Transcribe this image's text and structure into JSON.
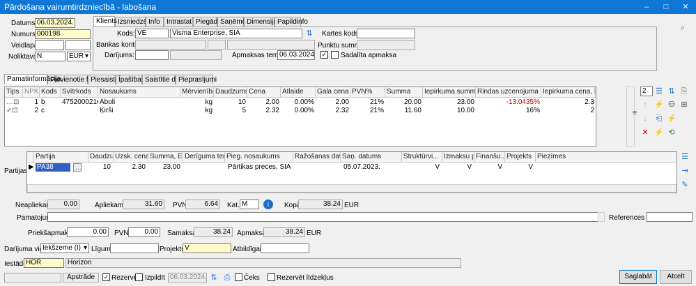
{
  "window": {
    "title": "Pārdošana vairumtirdzniecībā - labošana",
    "minimize": "–",
    "maximize": "□",
    "close": "✕"
  },
  "header": {
    "datums_label": "Datums:",
    "datums": "06.03.2024.",
    "numurs_label": "Numurs:",
    "numurs": "000198",
    "veidlapa_label": "Veidlapa:",
    "noliktava_label": "Noliktava:",
    "noliktava": "N",
    "currency": "EUR"
  },
  "top_tabs": [
    "Klients",
    "Izsniedzējs",
    "Info",
    "Intrastat",
    "Piegāde",
    "Saņēmējs",
    "Dimensijas",
    "Papildinfo"
  ],
  "client": {
    "kods_label": "Kods:",
    "kods": "VE",
    "name": "Visma Enterprise, SIA",
    "bankas_label": "Bankas konts:",
    "darijums_label": "Darījums:",
    "kartes_label": "Kartes kods:",
    "punktu_label": "Punktu summa:",
    "apmaksas_label": "Apmaksas termiņš:",
    "apmaksas": "06.03.2024.",
    "sadalita_label": "Sadalīta apmaksa"
  },
  "mid_tabs": [
    "Pamatinformācija",
    "Pievienotie faili",
    "Piesaistes",
    "Īpašības",
    "Saistītie dati",
    "Pieprasījumi"
  ],
  "items": {
    "columns": [
      "Tips",
      "NPK",
      "Kods",
      "Svītrkods",
      "Nosaukums",
      "Mērvienība",
      "Daudzums",
      "Cena",
      "Atlaide",
      "Gala cena",
      "PVN%",
      "Summa",
      "Iepirkuma summa, EUR",
      "Rindas uzcenojuma %",
      "Iepirkuma cena, EUR"
    ],
    "rows": [
      {
        "npk": "1",
        "kods": "b",
        "svitr": "4752000216...",
        "nos": "Āboli",
        "mv": "kg",
        "daudz": "10",
        "cena": "2.00",
        "atl": "0.00%",
        "gala": "2.00",
        "pvn": "21%",
        "summa": "20.00",
        "iep_summa": "23.00",
        "uzc": "-13.0435%",
        "iep_cena": "2.3"
      },
      {
        "npk": "2",
        "kods": "c",
        "svitr": "",
        "nos": "Ķirši",
        "mv": "kg",
        "daudz": "5",
        "cena": "2.32",
        "atl": "0.00%",
        "gala": "2.32",
        "pvn": "21%",
        "summa": "11.60",
        "iep_summa": "10.00",
        "uzc": "16%",
        "iep_cena": "2"
      }
    ],
    "counter": "2"
  },
  "partijas": {
    "label": "Partijas:",
    "columns": [
      "Partija",
      "Daudzums",
      "Uzsk. cena, EUR",
      "Summa, EUR",
      "Derīguma termiņš",
      "Pieg. nosaukums",
      "Ražošanas datums",
      "Saņ. datums",
      "Struktūrvi...",
      "Izmaksu pos...",
      "Finanšu...",
      "Projekts",
      "Piezīmes"
    ],
    "row": {
      "partija": "PA38",
      "daudz": "10",
      "cena": "2.30",
      "summa": "23.00",
      "pieg": "Pārtikas preces, SIA",
      "san": "05.07.2023.",
      "s": "V",
      "iz": "V",
      "fi": "V",
      "pr": "V"
    }
  },
  "totals": {
    "neapl_label": "Neapliekamā:",
    "neapl": "0.00",
    "apl_label": "Apliekamā:",
    "apl": "31.60",
    "pvn_label": "PVN:",
    "pvn": "6.64",
    "kat_label": "Kat.:",
    "kat": "M",
    "kopa_label": "Kopā:",
    "kopa": "38.24",
    "kopa_cur": "EUR",
    "pamat_label": "Pamatojums:",
    "ref_label": "References Nr.:",
    "prieksap_label": "Priekšapmaksa:",
    "prieksap": "0.00",
    "pvn2_label": "PVN:",
    "pvn2": "0.00",
    "samaksai_label": "Samaksai:",
    "samaksai": "38.24",
    "apmaksai_label": "Apmaksai:",
    "apmaksai": "38.24",
    "apmaksai_cur": "EUR"
  },
  "footer": {
    "darij_label": "Darījuma vieta:",
    "darij": "Iekšzeme (I)",
    "ligums_label": "Līgums:",
    "projekts_label": "Projekts:",
    "projekts": "V",
    "atbild_label": "Atbildīgais:",
    "iestade_label": "Iestāde:",
    "iestade": "HOR",
    "iestade_name": "Horizon",
    "apstrade": "Apstrāde",
    "rezervet": "Rezervēt",
    "izpildit": "Izpildīt",
    "izp_date": "06.03.2024.",
    "ceks": "Čeks",
    "rezervet_lidz": "Rezervēt līdzekļus",
    "saglabat": "Saglabāt",
    "atcelt": "Atcelt"
  }
}
